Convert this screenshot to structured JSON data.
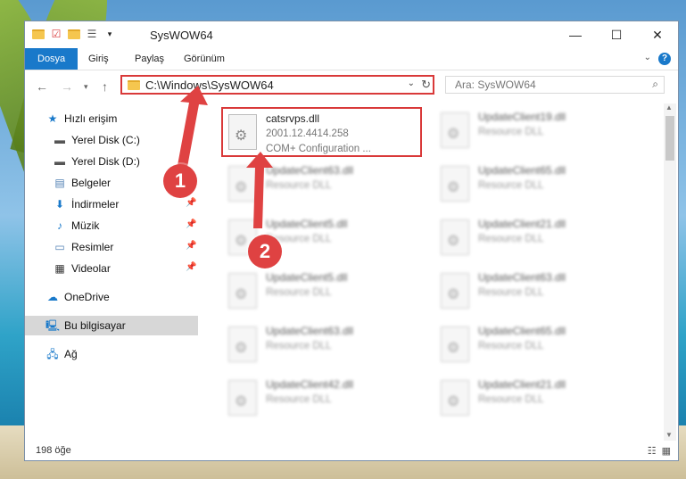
{
  "window": {
    "title": "SysWOW64"
  },
  "ribbon": {
    "tabs": [
      "Dosya",
      "Giriş",
      "Paylaş",
      "Görünüm"
    ],
    "help": "?"
  },
  "address": {
    "path": "C:\\Windows\\SysWOW64"
  },
  "search": {
    "placeholder": "Ara: SysWOW64"
  },
  "sidebar": {
    "items": [
      {
        "label": "Hızlı erişim",
        "icon": "star-icon"
      },
      {
        "label": "Yerel Disk (C:)",
        "icon": "drive-icon"
      },
      {
        "label": "Yerel Disk (D:)",
        "icon": "drive-icon"
      },
      {
        "label": "Belgeler",
        "icon": "documents-icon"
      },
      {
        "label": "İndirmeler",
        "icon": "download-icon"
      },
      {
        "label": "Müzik",
        "icon": "music-icon"
      },
      {
        "label": "Resimler",
        "icon": "pictures-icon"
      },
      {
        "label": "Videolar",
        "icon": "video-icon"
      },
      {
        "label": "OneDrive",
        "icon": "cloud-icon"
      },
      {
        "label": "Bu bilgisayar",
        "icon": "computer-icon"
      },
      {
        "label": "Ağ",
        "icon": "network-icon"
      }
    ]
  },
  "files": [
    {
      "name": "catsrvps.dll",
      "line2": "2001.12.4414.258",
      "line3": "COM+ Configuration ..."
    },
    {
      "name": "UpdateClient19.dll",
      "line2": "Resource DLL"
    },
    {
      "name": "UpdateClient63.dll",
      "line2": "Resource DLL"
    },
    {
      "name": "UpdateClient65.dll",
      "line2": "Resource DLL"
    },
    {
      "name": "UpdateClient5.dll",
      "line2": "Resource DLL"
    },
    {
      "name": "UpdateClient21.dll",
      "line2": "Resource DLL"
    },
    {
      "name": "UpdateClient5.dll",
      "line2": "Resource DLL"
    },
    {
      "name": "UpdateClient63.dll",
      "line2": "Resource DLL"
    },
    {
      "name": "UpdateClient63.dll",
      "line2": "Resource DLL"
    },
    {
      "name": "UpdateClient65.dll",
      "line2": "Resource DLL"
    },
    {
      "name": "UpdateClient42.dll",
      "line2": "Resource DLL"
    },
    {
      "name": "UpdateClient21.dll",
      "line2": "Resource DLL"
    }
  ],
  "status": {
    "count": "198 öğe"
  },
  "annotations": {
    "step1": "1",
    "step2": "2",
    "color": "#df4242"
  }
}
